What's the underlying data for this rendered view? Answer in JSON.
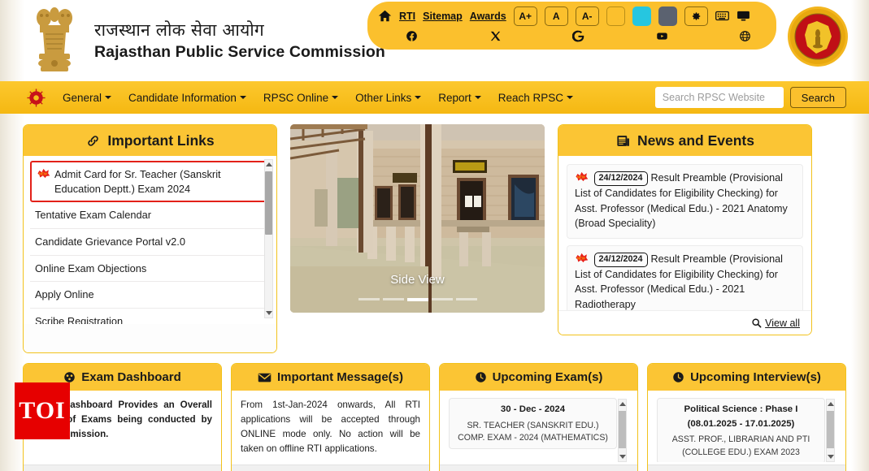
{
  "header": {
    "title_hi": "राजस्थान लोक सेवा आयोग",
    "title_en": "Rajasthan Public Service Commission",
    "emblem_left_name": "state-emblem-of-india",
    "emblem_right_name": "rpsc-seal"
  },
  "utility": {
    "home_label": "home-icon",
    "links": [
      {
        "label": "RTI"
      },
      {
        "label": "Sitemap"
      },
      {
        "label": "Awards"
      }
    ],
    "font_buttons": [
      {
        "label": "A+"
      },
      {
        "label": "A"
      },
      {
        "label": "A-"
      }
    ],
    "themes": [
      {
        "name": "theme-yellow",
        "color": "#fbc02d"
      },
      {
        "name": "theme-cyan",
        "color": "#26c6e0"
      },
      {
        "name": "theme-gray",
        "color": "#5b6270"
      }
    ],
    "tools": [
      {
        "name": "settings-gear-icon"
      },
      {
        "name": "keyboard-icon"
      },
      {
        "name": "screen-reader-icon"
      }
    ],
    "social": [
      {
        "name": "facebook-icon"
      },
      {
        "name": "x-twitter-icon"
      },
      {
        "name": "google-icon"
      },
      {
        "name": "youtube-icon"
      },
      {
        "name": "globe-icon"
      }
    ]
  },
  "nav": {
    "items": [
      {
        "label": "General"
      },
      {
        "label": "Candidate Information"
      },
      {
        "label": "RPSC Online"
      },
      {
        "label": "Other Links"
      },
      {
        "label": "Report"
      },
      {
        "label": "Reach RPSC"
      }
    ],
    "search": {
      "placeholder": "Search RPSC Website",
      "value": "",
      "button_label": "Search"
    }
  },
  "important_links": {
    "title": "Important Links",
    "items": [
      {
        "label": "Admit Card for Sr. Teacher (Sanskrit Education Deptt.) Exam 2024",
        "highlighted": true,
        "is_new": true
      },
      {
        "label": "Tentative Exam Calendar"
      },
      {
        "label": "Candidate Grievance Portal v2.0"
      },
      {
        "label": "Online Exam Objections"
      },
      {
        "label": "Apply Online"
      },
      {
        "label": "Scribe Registration"
      }
    ]
  },
  "carousel": {
    "caption": "Side View",
    "slide_count": 5,
    "active_index": 2
  },
  "news_events": {
    "title": "News and Events",
    "items": [
      {
        "date": "24/12/2024",
        "is_new": true,
        "text_before": "",
        "text": "Result Preamble (Provisional List of Candidates for Eligibility Checking) for Asst. Professor (Medical Edu.) - 2021 Anatomy (Broad Speciality)"
      },
      {
        "date": "24/12/2024",
        "is_new": true,
        "text": "Result Preamble (Provisional List of Candidates for Eligibility Checking) for Asst. Professor (Medical Edu.) - 2021 Radiotherapy"
      }
    ],
    "view_all_label": "View all"
  },
  "bottom_cards": {
    "exam_dashboard": {
      "title": "Exam Dashboard",
      "body": "Exam Dashboard Provides an Overall Status of Exams being conducted by the Commission."
    },
    "important_messages": {
      "title": "Important Message(s)",
      "body": "From 1st-Jan-2024 onwards, All RTI applications will be accepted through ONLINE mode only. No action will be taken on offline RTI applications."
    },
    "upcoming_exams": {
      "title": "Upcoming Exam(s)",
      "date": "30 - Dec - 2024",
      "name": "SR. TEACHER (SANSKRIT EDU.) COMP. EXAM - 2024 (MATHEMATICS)"
    },
    "upcoming_interviews": {
      "title": "Upcoming Interview(s)",
      "date": "Political Science : Phase I (08.01.2025 - 17.01.2025)",
      "name": "ASST. PROF., LIBRARIAN AND PTI (COLLEGE EDU.) EXAM 2023"
    }
  },
  "watermark": {
    "label": "TOI"
  },
  "colors": {
    "brand_yellow": "#fbc02d",
    "header_yellow": "#fbc534",
    "border_yellow": "#f2c21c",
    "highlight_red": "#e32119",
    "toi_red": "#e60000"
  }
}
